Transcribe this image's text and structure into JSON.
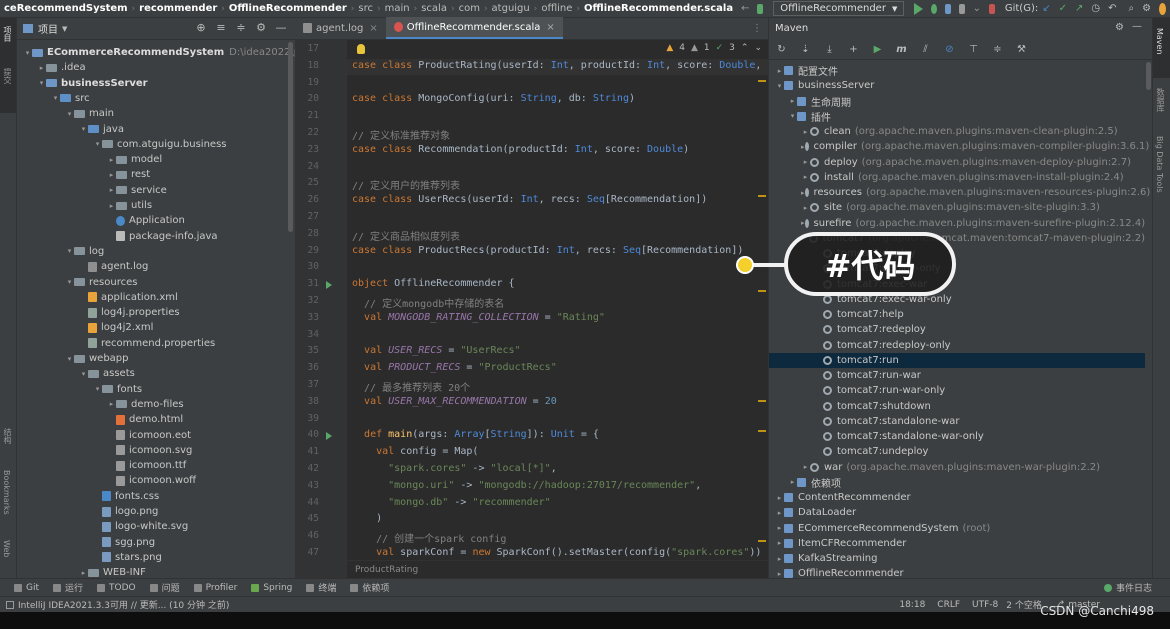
{
  "topbar": {
    "crumbs": [
      "ceRecommendSystem",
      "recommender",
      "OfflineRecommender",
      "src",
      "main",
      "scala",
      "com",
      "atguigu",
      "offline",
      "OfflineRecommender.scala"
    ],
    "run_config": "OfflineRecommender",
    "git_label": "Git(G):"
  },
  "left_strip": {
    "project": "项目",
    "commit": "提交",
    "structure": "结构",
    "bookmarks": "Bookmarks",
    "web": "Web"
  },
  "project": {
    "title": "项目",
    "root_name": "ECommerceRecommendSystem",
    "root_path": "D:\\idea2022\\project",
    "items": [
      {
        "label": ".idea"
      },
      {
        "label": "businessServer"
      },
      {
        "label": "src"
      },
      {
        "label": "main"
      },
      {
        "label": "java"
      },
      {
        "label": "com.atguigu.business"
      },
      {
        "label": "model"
      },
      {
        "label": "rest"
      },
      {
        "label": "service"
      },
      {
        "label": "utils"
      },
      {
        "label": "Application"
      },
      {
        "label": "package-info.java"
      },
      {
        "label": "log"
      },
      {
        "label": "agent.log"
      },
      {
        "label": "resources"
      },
      {
        "label": "application.xml"
      },
      {
        "label": "log4j.properties"
      },
      {
        "label": "log4j2.xml"
      },
      {
        "label": "recommend.properties"
      },
      {
        "label": "webapp"
      },
      {
        "label": "assets"
      },
      {
        "label": "fonts"
      },
      {
        "label": "demo-files"
      },
      {
        "label": "demo.html"
      },
      {
        "label": "icomoon.eot"
      },
      {
        "label": "icomoon.svg"
      },
      {
        "label": "icomoon.ttf"
      },
      {
        "label": "icomoon.woff"
      },
      {
        "label": "fonts.css"
      },
      {
        "label": "logo.png"
      },
      {
        "label": "logo-white.svg"
      },
      {
        "label": "sgg.png"
      },
      {
        "label": "stars.png"
      },
      {
        "label": "WEB-INF"
      }
    ]
  },
  "tabs": [
    {
      "label": "agent.log"
    },
    {
      "label": "OfflineRecommender.scala"
    }
  ],
  "editor": {
    "inspections": {
      "warnings": "4",
      "weak": "1",
      "typos": "3"
    },
    "line_numbers": [
      "17",
      "18",
      "19",
      "20",
      "21",
      "22",
      "23",
      "24",
      "25",
      "26",
      "27",
      "28",
      "29",
      "30",
      "31",
      "32",
      "33",
      "34",
      "35",
      "36",
      "37",
      "38",
      "39",
      "40",
      "41",
      "42",
      "43",
      "44",
      "45",
      "46",
      "47"
    ],
    "lines": {
      "l18": "case class ProductRating(userId: Int, productId: Int, score: Double,",
      "l20": "case class MongoConfig(uri: String, db: String)",
      "l22": "// 定义标准推荐对象",
      "l23": "case class Recommendation(productId: Int, score: Double)",
      "l25": "// 定义用户的推荐列表",
      "l26": "case class UserRecs(userId: Int, recs: Seq[Recommendation])",
      "l28": "// 定义商品相似度列表",
      "l29": "case class ProductRecs(productId: Int, recs: Seq[Recommendation])",
      "l31": "object OfflineRecommender {",
      "l32": "  // 定义mongodb中存储的表名",
      "l33": "  val MONGODB_RATING_COLLECTION = \"Rating\"",
      "l35": "  val USER_RECS = \"UserRecs\"",
      "l36": "  val PRODUCT_RECS = \"ProductRecs\"",
      "l37": "  // 最多推荐列表 20个",
      "l38": "  val USER_MAX_RECOMMENDATION = 20",
      "l40": "  def main(args: Array[String]): Unit = {",
      "l41": "    val config = Map(",
      "l42": "      \"spark.cores\" -> \"local[*]\",",
      "l43": "      \"mongo.uri\" -> \"mongodb://hadoop:27017/recommender\",",
      "l44": "      \"mongo.db\" -> \"recommender\"",
      "l45": "    )",
      "l46": "    // 创建一个spark config",
      "l47": "    val sparkConf = new SparkConf().setMaster(config(\"spark.cores\"))"
    },
    "breadcrumb": "ProductRating"
  },
  "maven": {
    "title": "Maven",
    "rows": [
      {
        "label": "配置文件"
      },
      {
        "label": "businessServer"
      },
      {
        "label": "生命周期"
      },
      {
        "label": "插件"
      },
      {
        "label": "clean",
        "suffix": "(org.apache.maven.plugins:maven-clean-plugin:2.5)"
      },
      {
        "label": "compiler",
        "suffix": "(org.apache.maven.plugins:maven-compiler-plugin:3.6.1)"
      },
      {
        "label": "deploy",
        "suffix": "(org.apache.maven.plugins:maven-deploy-plugin:2.7)"
      },
      {
        "label": "install",
        "suffix": "(org.apache.maven.plugins:maven-install-plugin:2.4)"
      },
      {
        "label": "resources",
        "suffix": "(org.apache.maven.plugins:maven-resources-plugin:2.6)"
      },
      {
        "label": "site",
        "suffix": "(org.apache.maven.plugins:maven-site-plugin:3.3)"
      },
      {
        "label": "surefire",
        "suffix": "(org.apache.maven.plugins:maven-surefire-plugin:2.12.4)"
      },
      {
        "label": "tomcat7",
        "suffix": "(org.apache.tomcat.maven:tomcat7-maven-plugin:2.2)"
      },
      {
        "label": "tomcat7:deploy"
      },
      {
        "label": "tomcat7:deploy-only"
      },
      {
        "label": "tomcat7:exec-war"
      },
      {
        "label": "tomcat7:exec-war-only"
      },
      {
        "label": "tomcat7:help"
      },
      {
        "label": "tomcat7:redeploy"
      },
      {
        "label": "tomcat7:redeploy-only"
      },
      {
        "label": "tomcat7:run"
      },
      {
        "label": "tomcat7:run-war"
      },
      {
        "label": "tomcat7:run-war-only"
      },
      {
        "label": "tomcat7:shutdown"
      },
      {
        "label": "tomcat7:standalone-war"
      },
      {
        "label": "tomcat7:standalone-war-only"
      },
      {
        "label": "tomcat7:undeploy"
      },
      {
        "label": "war",
        "suffix": "(org.apache.maven.plugins:maven-war-plugin:2.2)"
      },
      {
        "label": "依赖项"
      },
      {
        "label": "ContentRecommender"
      },
      {
        "label": "DataLoader"
      },
      {
        "label": "ECommerceRecommendSystem",
        "suffix": "(root)"
      },
      {
        "label": "ItemCFRecommender"
      },
      {
        "label": "KafkaStreaming"
      },
      {
        "label": "OfflineRecommender"
      }
    ]
  },
  "right_strip": {
    "maven": "Maven",
    "database": "数据库",
    "bigdata": "Big Data Tools"
  },
  "bottom_tools": [
    {
      "label": "Git"
    },
    {
      "label": "运行"
    },
    {
      "label": "TODO"
    },
    {
      "label": "问题"
    },
    {
      "label": "Profiler"
    },
    {
      "label": "Spring"
    },
    {
      "label": "终端"
    },
    {
      "label": "依赖项"
    }
  ],
  "event_log": "事件日志",
  "status": {
    "message": "IntelliJ IDEA2021.3.3可用 // 更新... (10 分钟 之前)",
    "position": "18:18",
    "line_sep": "CRLF",
    "encoding": "UTF-8",
    "indent": "2 个空格",
    "branch": "master"
  },
  "annotation": {
    "text": "#代码"
  },
  "watermark": "CSDN @Canchi498"
}
